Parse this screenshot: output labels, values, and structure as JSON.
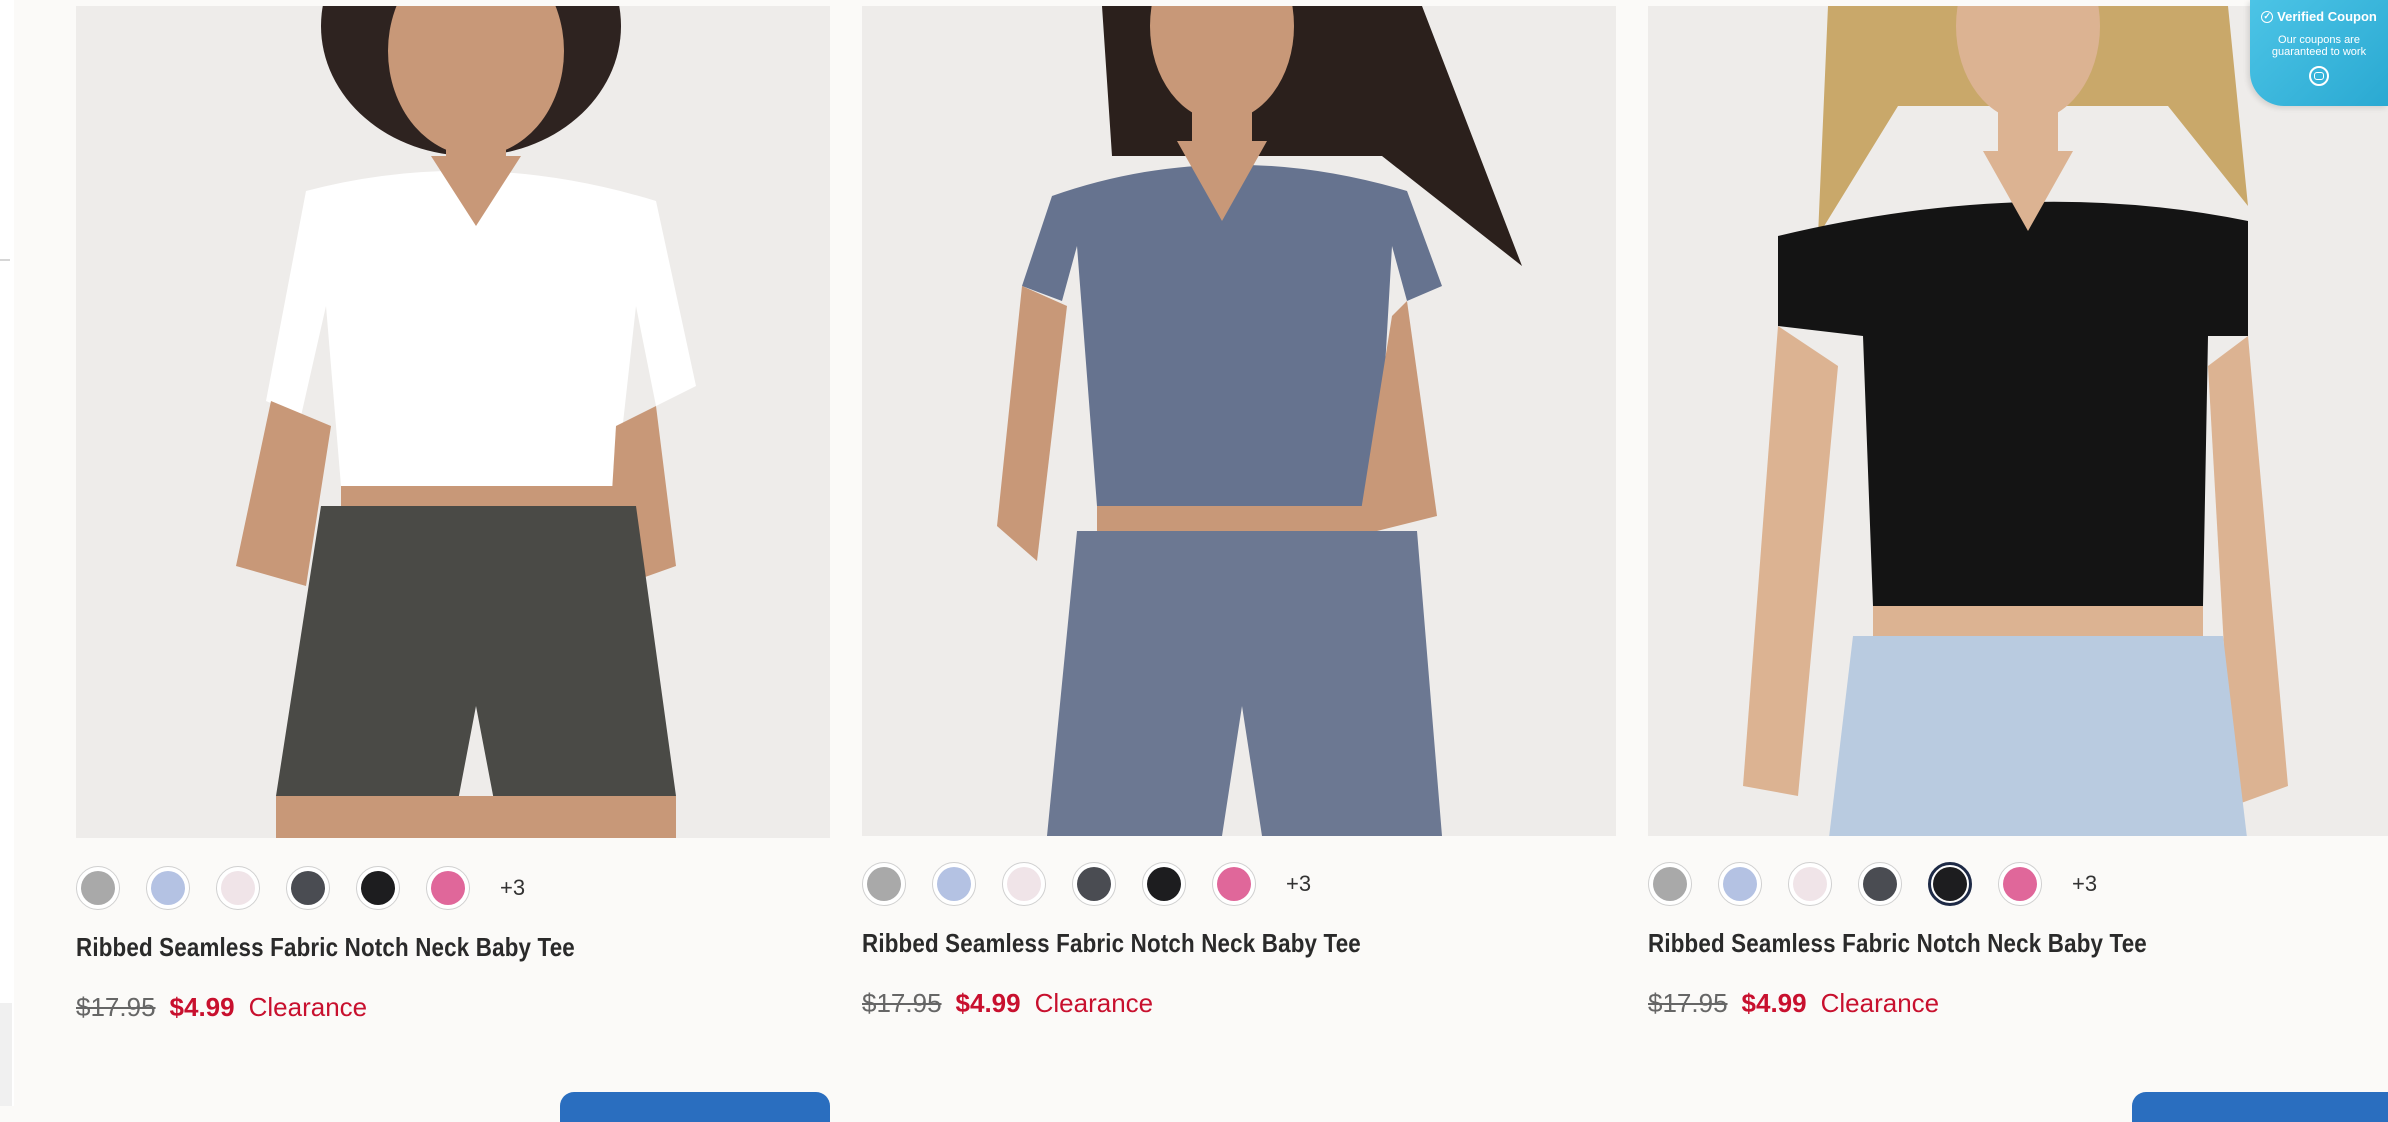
{
  "products": [
    {
      "name": "Ribbed Seamless Fabric Notch Neck Baby Tee",
      "original_price": "$17.95",
      "sale_price": "$4.99",
      "tag": "Clearance",
      "more_colors": "+3",
      "shirt_color": "#ffffff",
      "bottom_color": "#4a4a46",
      "hair_color": "#2e2320",
      "swatches": [
        "#a9a9a9",
        "#b4c2e3",
        "#f0e4e8",
        "#4a4c52",
        "#1d1d1f",
        "#e0679a"
      ],
      "selected_swatch": -1
    },
    {
      "name": "Ribbed Seamless Fabric Notch Neck Baby Tee",
      "original_price": "$17.95",
      "sale_price": "$4.99",
      "tag": "Clearance",
      "more_colors": "+3",
      "shirt_color": "#66738f",
      "bottom_color": "#6c7892",
      "hair_color": "#2b201c",
      "swatches": [
        "#a9a9a9",
        "#b4c2e3",
        "#f0e4e8",
        "#4a4c52",
        "#1d1d1f",
        "#e0679a"
      ],
      "selected_swatch": -1
    },
    {
      "name": "Ribbed Seamless Fabric Notch Neck Baby Tee",
      "original_price": "$17.95",
      "sale_price": "$4.99",
      "tag": "Clearance",
      "more_colors": "+3",
      "shirt_color": "#141414",
      "bottom_color": "#b9cbe0",
      "hair_color": "#c9a86a",
      "swatches": [
        "#a9a9a9",
        "#b4c2e3",
        "#f0e4e8",
        "#4a4c52",
        "#1d1d1f",
        "#e0679a"
      ],
      "selected_swatch": 4
    }
  ],
  "coupon": {
    "title": "Verified Coupon",
    "subtitle": "Our coupons are guaranteed to work"
  }
}
